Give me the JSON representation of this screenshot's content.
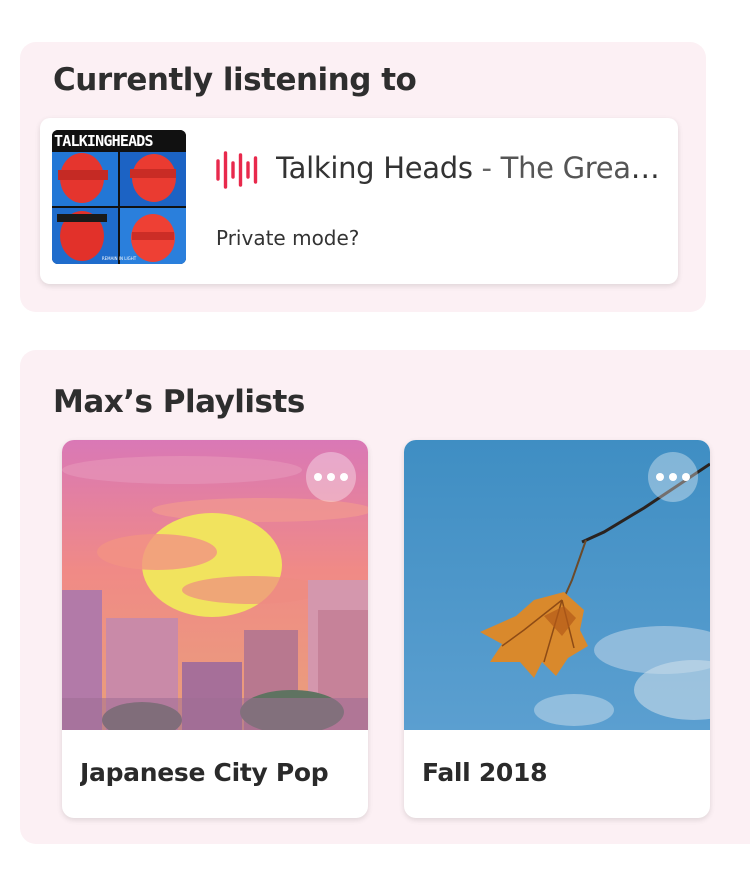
{
  "now_playing": {
    "section_title": "Currently listening to",
    "album_art": {
      "band_logo": "TALKINGHEADS",
      "album_subtitle": "REMAIN IN LIGHT"
    },
    "artist": "Talking Heads",
    "separator": " - ",
    "album": "The Great Curve",
    "private_mode_label": "Private mode?",
    "playing_icon": "sound-wave-icon",
    "accent_color": "#e8294c"
  },
  "playlists": {
    "section_title": "Max’s Playlists",
    "items": [
      {
        "name": "Japanese City Pop",
        "art": "anime-sunset-city",
        "menu_icon": "more-horizontal-icon"
      },
      {
        "name": "Fall 2018",
        "art": "autumn-leaf-sky",
        "menu_icon": "more-horizontal-icon"
      }
    ]
  },
  "colors": {
    "panel_background": "#fcf0f4",
    "card_background": "#ffffff",
    "title_text": "#2e2e2e"
  }
}
